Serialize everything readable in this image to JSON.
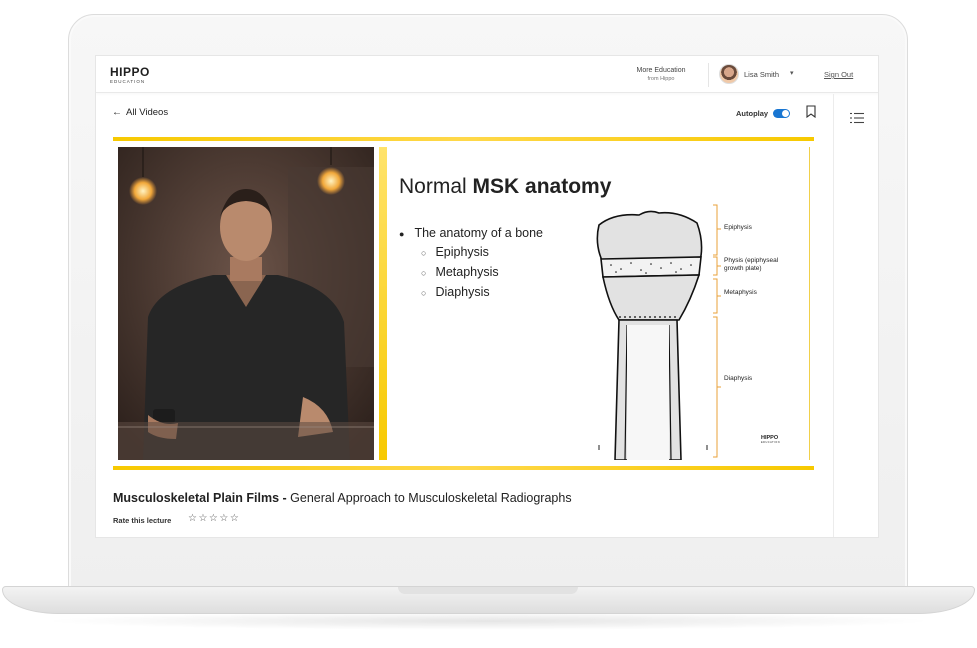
{
  "header": {
    "logo_main": "HIPPO",
    "logo_sub": "EDUCATION",
    "more_education": "More Education",
    "more_education_sub": "from Hippo",
    "user_name": "Lisa Smith",
    "sign_out": "Sign Out"
  },
  "toolbar": {
    "back_label": "All Videos",
    "autoplay_label": "Autoplay",
    "autoplay_on": true
  },
  "slide": {
    "title_regular": "Normal",
    "title_bold": "MSK anatomy",
    "bullet": "The anatomy of a bone",
    "sub_bullets": [
      "Epiphysis",
      "Metaphysis",
      "Diaphysis"
    ],
    "labels": {
      "epiphysis": "Epiphysis",
      "physis_line1": "Physis (epiphyseal",
      "physis_line2": "growth plate)",
      "metaphysis": "Metaphysis",
      "diaphysis": "Diaphysis"
    },
    "logo_main": "HIPPO",
    "logo_sub": "EDUCATION"
  },
  "lecture": {
    "title_bold": "Musculoskeletal Plain Films -",
    "title_rest": "General Approach to Musculoskeletal Radiographs",
    "rate_label": "Rate this lecture",
    "stars": "☆☆☆☆☆"
  },
  "colors": {
    "accent_yellow": "#f7c900",
    "toggle_blue": "#1976d2",
    "bone_orange": "#e8a13a"
  }
}
